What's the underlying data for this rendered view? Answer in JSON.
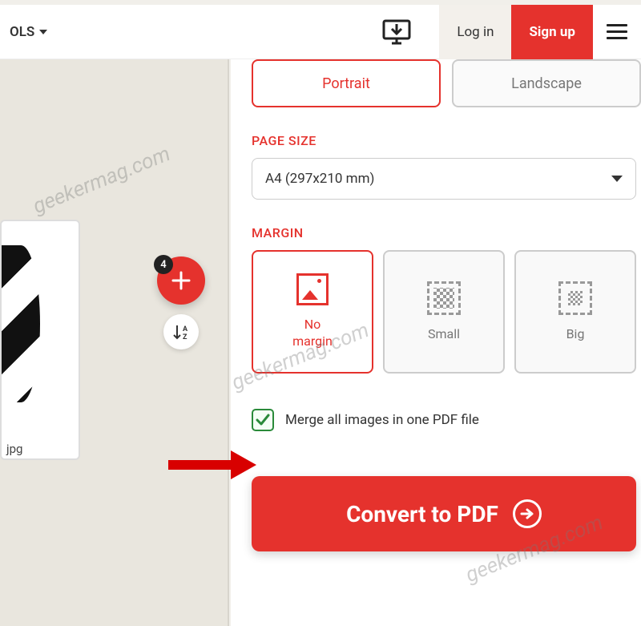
{
  "header": {
    "tools_label": "OLS",
    "login_label": "Log in",
    "signup_label": "Sign up"
  },
  "left": {
    "badge_count": "4",
    "thumb_ext": "jpg"
  },
  "orientation": {
    "portrait": "Portrait",
    "landscape": "Landscape"
  },
  "page_size": {
    "title": "PAGE SIZE",
    "selected": "A4 (297x210 mm)"
  },
  "margin": {
    "title": "MARGIN",
    "options": {
      "none_l1": "No",
      "none_l2": "margin",
      "small": "Small",
      "big": "Big"
    }
  },
  "merge": {
    "label": "Merge all images in one PDF file"
  },
  "convert": {
    "label": "Convert to PDF"
  },
  "watermark": "geekermag.com"
}
